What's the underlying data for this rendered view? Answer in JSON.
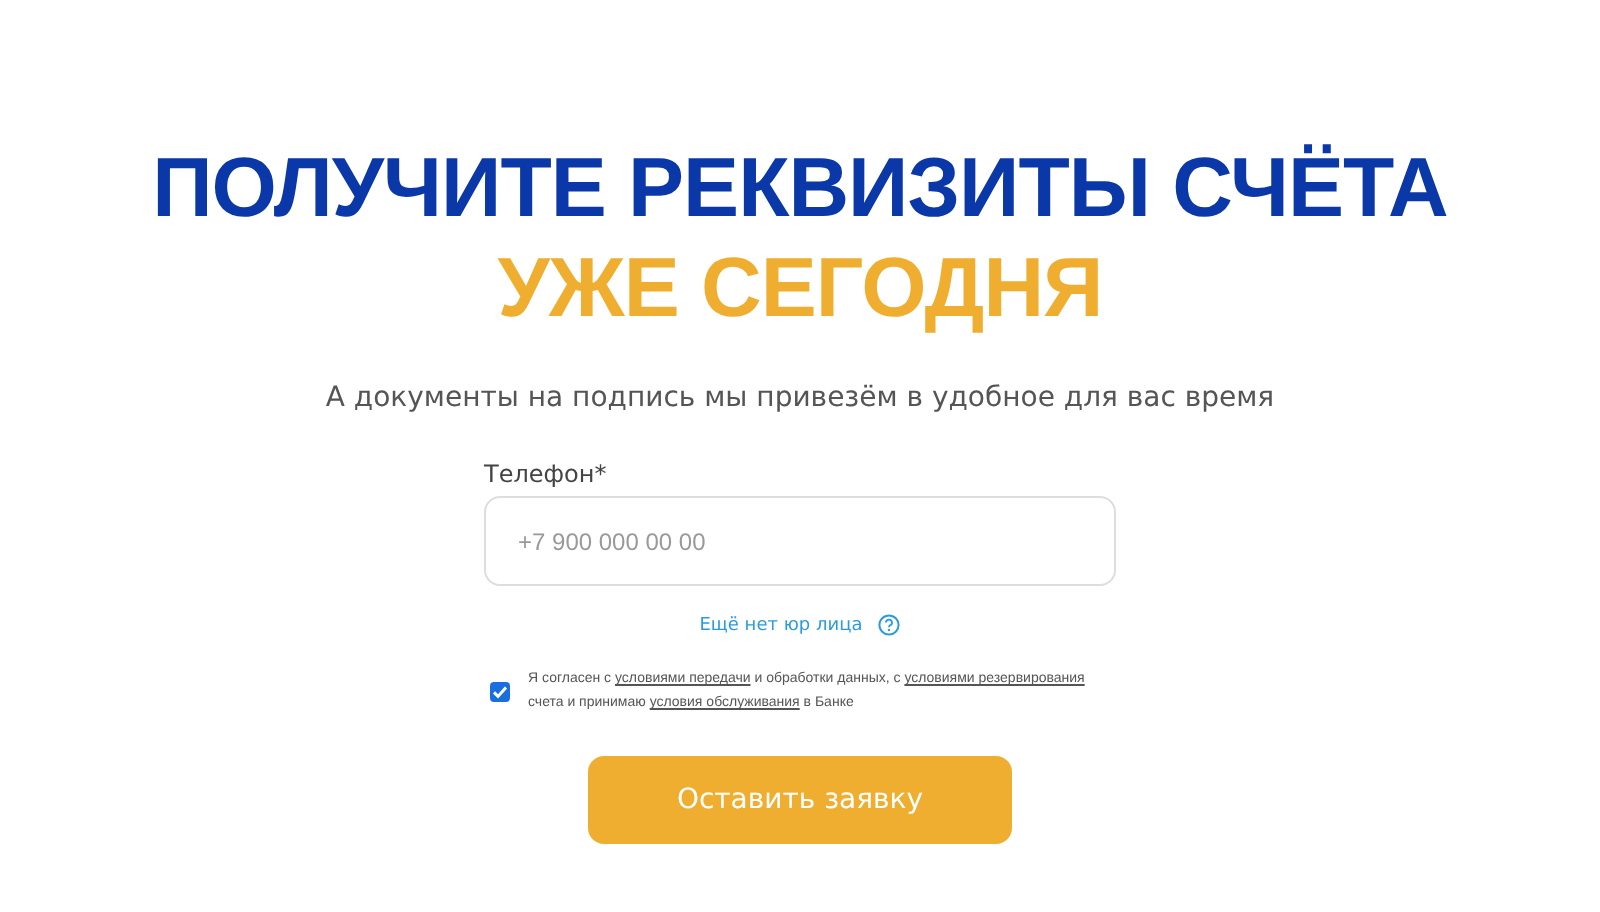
{
  "heading": {
    "line_1": "ПОЛУЧИТЕ РЕКВИЗИТЫ СЧЁТА",
    "line_2": "УЖЕ СЕГОДНЯ"
  },
  "subtitle": "А документы на подпись мы привезём в удобное для вас время",
  "phone_field": {
    "label": "Телефон*",
    "placeholder": "+7 900 000 00 00"
  },
  "no_company_link": "Ещё нет юр лица",
  "consent": {
    "checked": true,
    "parts": [
      {
        "text": "Я согласен с ",
        "kind": "text"
      },
      {
        "text": "условиями передачи",
        "kind": "link"
      },
      {
        "text": " и обработки данных, с ",
        "kind": "text"
      },
      {
        "text": "условиями резервирования",
        "kind": "link"
      },
      {
        "text": " счета и принимаю ",
        "kind": "text"
      },
      {
        "text": "условия обслуживания",
        "kind": "link"
      },
      {
        "text": " в Банке",
        "kind": "text"
      }
    ]
  },
  "submit_button": "Оставить заявку"
}
